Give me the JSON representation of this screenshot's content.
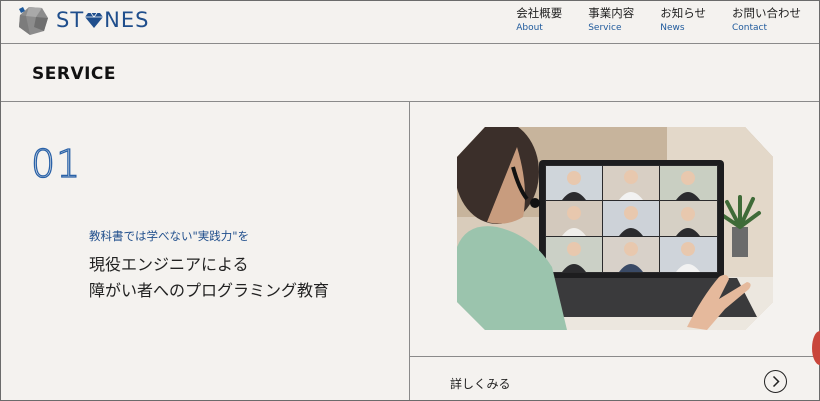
{
  "brand": {
    "name": "ST NES",
    "logo_icon": "stone-icon",
    "accent": "#1f4e8c"
  },
  "nav": [
    {
      "ja": "会社概要",
      "en": "About"
    },
    {
      "ja": "事業内容",
      "en": "Service"
    },
    {
      "ja": "お知らせ",
      "en": "News"
    },
    {
      "ja": "お問い合わせ",
      "en": "Contact"
    }
  ],
  "section": {
    "title": "SERVICE"
  },
  "service": {
    "number": "01",
    "catch": "教科書では学べない\"実践力\"を",
    "lead_line1": "現役エンジニアによる",
    "lead_line2": "障がい者へのプログラミング教育",
    "more_label": "詳しくみる",
    "more_icon": "chevron-right-icon"
  }
}
